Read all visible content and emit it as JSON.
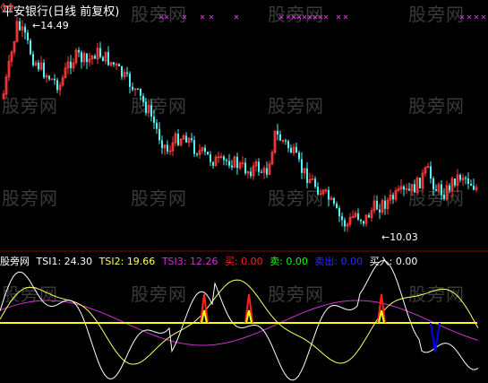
{
  "chart": {
    "title": "平安银行(日线 前复权)",
    "high_label": "14.49",
    "low_label": "←10.03",
    "high_arrow": "←"
  },
  "indicator": {
    "name": "股旁网",
    "tsi1_label": "TSI1:",
    "tsi1_value": "24.30",
    "tsi2_label": "TSI2:",
    "tsi2_value": "19.66",
    "tsi3_label": "TSI3:",
    "tsi3_value": "12.26",
    "buy_label": "买:",
    "buy_value": "0.00",
    "sell_label": "卖:",
    "sell_value": "0.00",
    "sellout_label": "卖出:",
    "sellout_value": "0.00",
    "buyin_label": "买入:",
    "buyin_value": "0.00"
  },
  "colors": {
    "up": "#ff3b3b",
    "down": "#4ff5f5",
    "tsi1": "#ffffff",
    "tsi2": "#ffff66",
    "tsi3": "#cc33cc",
    "buy": "#ff2020",
    "sell": "#00ff00",
    "sellout": "#0000ff",
    "buyin": "#ffffff",
    "baseline": "#ffff00",
    "marker": "#cc33cc"
  },
  "watermark": "股旁网"
}
